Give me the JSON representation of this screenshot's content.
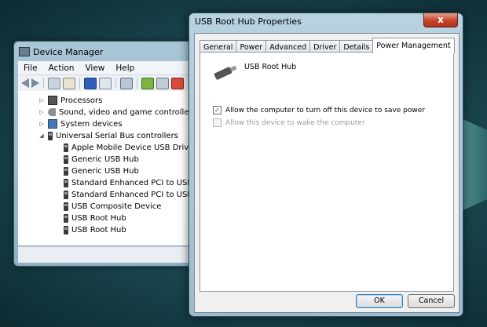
{
  "device_manager": {
    "title": "Device Manager",
    "menu": [
      "File",
      "Action",
      "View",
      "Help"
    ],
    "tree": [
      {
        "label": "Processors",
        "level": 1,
        "expander": "▷"
      },
      {
        "label": "Sound, video and game controllers",
        "level": 1,
        "expander": "▷"
      },
      {
        "label": "System devices",
        "level": 1,
        "expander": "▷"
      },
      {
        "label": "Universal Serial Bus controllers",
        "level": 1,
        "expander": "◢"
      },
      {
        "label": "Apple Mobile Device USB Driver",
        "level": 2
      },
      {
        "label": "Generic USB Hub",
        "level": 2
      },
      {
        "label": "Generic USB Hub",
        "level": 2
      },
      {
        "label": "Standard Enhanced PCI to USB Ho",
        "level": 2
      },
      {
        "label": "Standard Enhanced PCI to USB Ho",
        "level": 2
      },
      {
        "label": "USB Composite Device",
        "level": 2
      },
      {
        "label": "USB Root Hub",
        "level": 2
      },
      {
        "label": "USB Root Hub",
        "level": 2
      }
    ]
  },
  "dialog": {
    "title": "USB Root Hub Properties",
    "close": "x",
    "tabs": [
      "General",
      "Power",
      "Advanced",
      "Driver",
      "Details",
      "Power Management"
    ],
    "active_tab": "Power Management",
    "device_name": "USB Root Hub",
    "options": [
      {
        "label": "Allow the computer to turn off this device to save power",
        "checked": true,
        "enabled": true,
        "mark": "✓"
      },
      {
        "label": "Allow this device to wake the computer",
        "checked": false,
        "enabled": false,
        "mark": ""
      }
    ],
    "ok_label": "OK",
    "cancel_label": "Cancel"
  }
}
